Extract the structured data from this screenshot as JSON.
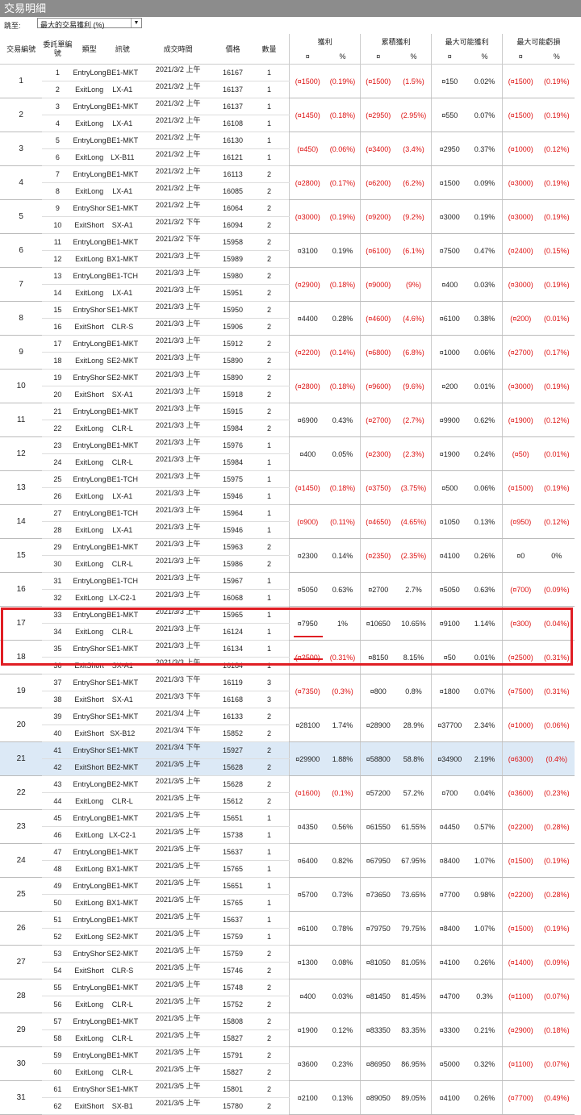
{
  "window_title": "交易明細",
  "toolbar": {
    "jump_label": "跳至:",
    "sort_value": "最大的交易獲利 (%)"
  },
  "headers": {
    "trade_no": "交易編號",
    "order_no": "委託單編號",
    "type": "類型",
    "signal": "訊號",
    "time": "成交時間",
    "price": "價格",
    "qty": "數量",
    "profit": "獲利",
    "cum": "累積獲利",
    "maxp": "最大可能獲利",
    "maxl": "最大可能虧損",
    "cur": "¤",
    "pct": "%"
  },
  "colors": {
    "negative": "#dd1111",
    "highlight_row": "#dce9f6",
    "annotation": "#e01e24"
  },
  "trades": [
    {
      "no": "1",
      "o": [
        [
          "1",
          "EntryLong",
          "BE1-MKT",
          "2021/3/2 上午",
          "16167",
          "1"
        ],
        [
          "2",
          "ExitLong",
          "LX-A1",
          "2021/3/2 上午",
          "16137",
          "1"
        ]
      ],
      "m": [
        "(¤1500)",
        "(0.19%)",
        "(¤1500)",
        "(1.5%)",
        "¤150",
        "0.02%",
        "(¤1500)",
        "(0.19%)"
      ]
    },
    {
      "no": "2",
      "o": [
        [
          "3",
          "EntryLong",
          "BE1-MKT",
          "2021/3/2 上午",
          "16137",
          "1"
        ],
        [
          "4",
          "ExitLong",
          "LX-A1",
          "2021/3/2 上午",
          "16108",
          "1"
        ]
      ],
      "m": [
        "(¤1450)",
        "(0.18%)",
        "(¤2950)",
        "(2.95%)",
        "¤550",
        "0.07%",
        "(¤1500)",
        "(0.19%)"
      ]
    },
    {
      "no": "3",
      "o": [
        [
          "5",
          "EntryLong",
          "BE1-MKT",
          "2021/3/2 上午",
          "16130",
          "1"
        ],
        [
          "6",
          "ExitLong",
          "LX-B11",
          "2021/3/2 上午",
          "16121",
          "1"
        ]
      ],
      "m": [
        "(¤450)",
        "(0.06%)",
        "(¤3400)",
        "(3.4%)",
        "¤2950",
        "0.37%",
        "(¤1000)",
        "(0.12%)"
      ]
    },
    {
      "no": "4",
      "o": [
        [
          "7",
          "EntryLong",
          "BE1-MKT",
          "2021/3/2 上午",
          "16113",
          "2"
        ],
        [
          "8",
          "ExitLong",
          "LX-A1",
          "2021/3/2 上午",
          "16085",
          "2"
        ]
      ],
      "m": [
        "(¤2800)",
        "(0.17%)",
        "(¤6200)",
        "(6.2%)",
        "¤1500",
        "0.09%",
        "(¤3000)",
        "(0.19%)"
      ]
    },
    {
      "no": "5",
      "o": [
        [
          "9",
          "EntryShort",
          "SE1-MKT",
          "2021/3/2 上午",
          "16064",
          "2"
        ],
        [
          "10",
          "ExitShort",
          "SX-A1",
          "2021/3/2 下午",
          "16094",
          "2"
        ]
      ],
      "m": [
        "(¤3000)",
        "(0.19%)",
        "(¤9200)",
        "(9.2%)",
        "¤3000",
        "0.19%",
        "(¤3000)",
        "(0.19%)"
      ]
    },
    {
      "no": "6",
      "o": [
        [
          "11",
          "EntryLong",
          "BE1-MKT",
          "2021/3/2 下午",
          "15958",
          "2"
        ],
        [
          "12",
          "ExitLong",
          "BX1-MKT",
          "2021/3/3 上午",
          "15989",
          "2"
        ]
      ],
      "m": [
        "¤3100",
        "0.19%",
        "(¤6100)",
        "(6.1%)",
        "¤7500",
        "0.47%",
        "(¤2400)",
        "(0.15%)"
      ]
    },
    {
      "no": "7",
      "o": [
        [
          "13",
          "EntryLong",
          "BE1-TCH",
          "2021/3/3 上午",
          "15980",
          "2"
        ],
        [
          "14",
          "ExitLong",
          "LX-A1",
          "2021/3/3 上午",
          "15951",
          "2"
        ]
      ],
      "m": [
        "(¤2900)",
        "(0.18%)",
        "(¤9000)",
        "(9%)",
        "¤400",
        "0.03%",
        "(¤3000)",
        "(0.19%)"
      ]
    },
    {
      "no": "8",
      "o": [
        [
          "15",
          "EntryShort",
          "SE1-MKT",
          "2021/3/3 上午",
          "15950",
          "2"
        ],
        [
          "16",
          "ExitShort",
          "CLR-S",
          "2021/3/3 上午",
          "15906",
          "2"
        ]
      ],
      "m": [
        "¤4400",
        "0.28%",
        "(¤4600)",
        "(4.6%)",
        "¤6100",
        "0.38%",
        "(¤200)",
        "(0.01%)"
      ]
    },
    {
      "no": "9",
      "o": [
        [
          "17",
          "EntryLong",
          "BE1-MKT",
          "2021/3/3 上午",
          "15912",
          "2"
        ],
        [
          "18",
          "ExitLong",
          "SE2-MKT",
          "2021/3/3 上午",
          "15890",
          "2"
        ]
      ],
      "m": [
        "(¤2200)",
        "(0.14%)",
        "(¤6800)",
        "(6.8%)",
        "¤1000",
        "0.06%",
        "(¤2700)",
        "(0.17%)"
      ]
    },
    {
      "no": "10",
      "o": [
        [
          "19",
          "EntryShort",
          "SE2-MKT",
          "2021/3/3 上午",
          "15890",
          "2"
        ],
        [
          "20",
          "ExitShort",
          "SX-A1",
          "2021/3/3 上午",
          "15918",
          "2"
        ]
      ],
      "m": [
        "(¤2800)",
        "(0.18%)",
        "(¤9600)",
        "(9.6%)",
        "¤200",
        "0.01%",
        "(¤3000)",
        "(0.19%)"
      ]
    },
    {
      "no": "11",
      "o": [
        [
          "21",
          "EntryLong",
          "BE1-MKT",
          "2021/3/3 上午",
          "15915",
          "2"
        ],
        [
          "22",
          "ExitLong",
          "CLR-L",
          "2021/3/3 上午",
          "15984",
          "2"
        ]
      ],
      "m": [
        "¤6900",
        "0.43%",
        "(¤2700)",
        "(2.7%)",
        "¤9900",
        "0.62%",
        "(¤1900)",
        "(0.12%)"
      ]
    },
    {
      "no": "12",
      "o": [
        [
          "23",
          "EntryLong",
          "BE1-MKT",
          "2021/3/3 上午",
          "15976",
          "1"
        ],
        [
          "24",
          "ExitLong",
          "CLR-L",
          "2021/3/3 上午",
          "15984",
          "1"
        ]
      ],
      "m": [
        "¤400",
        "0.05%",
        "(¤2300)",
        "(2.3%)",
        "¤1900",
        "0.24%",
        "(¤50)",
        "(0.01%)"
      ]
    },
    {
      "no": "13",
      "o": [
        [
          "25",
          "EntryLong",
          "BE1-TCH",
          "2021/3/3 上午",
          "15975",
          "1"
        ],
        [
          "26",
          "ExitLong",
          "LX-A1",
          "2021/3/3 上午",
          "15946",
          "1"
        ]
      ],
      "m": [
        "(¤1450)",
        "(0.18%)",
        "(¤3750)",
        "(3.75%)",
        "¤500",
        "0.06%",
        "(¤1500)",
        "(0.19%)"
      ]
    },
    {
      "no": "14",
      "o": [
        [
          "27",
          "EntryLong",
          "BE1-TCH",
          "2021/3/3 上午",
          "15964",
          "1"
        ],
        [
          "28",
          "ExitLong",
          "LX-A1",
          "2021/3/3 上午",
          "15946",
          "1"
        ]
      ],
      "m": [
        "(¤900)",
        "(0.11%)",
        "(¤4650)",
        "(4.65%)",
        "¤1050",
        "0.13%",
        "(¤950)",
        "(0.12%)"
      ]
    },
    {
      "no": "15",
      "o": [
        [
          "29",
          "EntryLong",
          "BE1-MKT",
          "2021/3/3 上午",
          "15963",
          "2"
        ],
        [
          "30",
          "ExitLong",
          "CLR-L",
          "2021/3/3 上午",
          "15986",
          "2"
        ]
      ],
      "m": [
        "¤2300",
        "0.14%",
        "(¤2350)",
        "(2.35%)",
        "¤4100",
        "0.26%",
        "¤0",
        "0%"
      ]
    },
    {
      "no": "16",
      "o": [
        [
          "31",
          "EntryLong",
          "BE1-TCH",
          "2021/3/3 上午",
          "15967",
          "1"
        ],
        [
          "32",
          "ExitLong",
          "LX-C2-1",
          "2021/3/3 上午",
          "16068",
          "1"
        ]
      ],
      "m": [
        "¤5050",
        "0.63%",
        "¤2700",
        "2.7%",
        "¤5050",
        "0.63%",
        "(¤700)",
        "(0.09%)"
      ]
    },
    {
      "no": "17",
      "o": [
        [
          "33",
          "EntryLong",
          "BE1-MKT",
          "2021/3/3 上午",
          "15965",
          "1"
        ],
        [
          "34",
          "ExitLong",
          "CLR-L",
          "2021/3/3 上午",
          "16124",
          "1"
        ]
      ],
      "m": [
        "¤7950",
        "1%",
        "¤10650",
        "10.65%",
        "¤9100",
        "1.14%",
        "(¤300)",
        "(0.04%)"
      ]
    },
    {
      "no": "18",
      "o": [
        [
          "35",
          "EntryShort",
          "SE1-MKT",
          "2021/3/3 上午",
          "16134",
          "1"
        ],
        [
          "36",
          "ExitShort",
          "SX-A1",
          "2021/3/3 上午",
          "16184",
          "1"
        ]
      ],
      "m": [
        "(¤2500)",
        "(0.31%)",
        "¤8150",
        "8.15%",
        "¤50",
        "0.01%",
        "(¤2500)",
        "(0.31%)"
      ]
    },
    {
      "no": "19",
      "o": [
        [
          "37",
          "EntryShort",
          "SE1-MKT",
          "2021/3/3 下午",
          "16119",
          "3"
        ],
        [
          "38",
          "ExitShort",
          "SX-A1",
          "2021/3/3 下午",
          "16168",
          "3"
        ]
      ],
      "m": [
        "(¤7350)",
        "(0.3%)",
        "¤800",
        "0.8%",
        "¤1800",
        "0.07%",
        "(¤7500)",
        "(0.31%)"
      ]
    },
    {
      "no": "20",
      "o": [
        [
          "39",
          "EntryShort",
          "SE1-MKT",
          "2021/3/4 上午",
          "16133",
          "2"
        ],
        [
          "40",
          "ExitShort",
          "SX-B12",
          "2021/3/4 下午",
          "15852",
          "2"
        ]
      ],
      "m": [
        "¤28100",
        "1.74%",
        "¤28900",
        "28.9%",
        "¤37700",
        "2.34%",
        "(¤1000)",
        "(0.06%)"
      ]
    },
    {
      "no": "21",
      "o": [
        [
          "41",
          "EntryShort",
          "SE1-MKT",
          "2021/3/4 下午",
          "15927",
          "2"
        ],
        [
          "42",
          "ExitShort",
          "BE2-MKT",
          "2021/3/5 上午",
          "15628",
          "2"
        ]
      ],
      "m": [
        "¤29900",
        "1.88%",
        "¤58800",
        "58.8%",
        "¤34900",
        "2.19%",
        "(¤6300)",
        "(0.4%)"
      ]
    },
    {
      "no": "22",
      "o": [
        [
          "43",
          "EntryLong",
          "BE2-MKT",
          "2021/3/5 上午",
          "15628",
          "2"
        ],
        [
          "44",
          "ExitLong",
          "CLR-L",
          "2021/3/5 上午",
          "15612",
          "2"
        ]
      ],
      "m": [
        "(¤1600)",
        "(0.1%)",
        "¤57200",
        "57.2%",
        "¤700",
        "0.04%",
        "(¤3600)",
        "(0.23%)"
      ]
    },
    {
      "no": "23",
      "o": [
        [
          "45",
          "EntryLong",
          "BE1-MKT",
          "2021/3/5 上午",
          "15651",
          "1"
        ],
        [
          "46",
          "ExitLong",
          "LX-C2-1",
          "2021/3/5 上午",
          "15738",
          "1"
        ]
      ],
      "m": [
        "¤4350",
        "0.56%",
        "¤61550",
        "61.55%",
        "¤4450",
        "0.57%",
        "(¤2200)",
        "(0.28%)"
      ]
    },
    {
      "no": "24",
      "o": [
        [
          "47",
          "EntryLong",
          "BE1-MKT",
          "2021/3/5 上午",
          "15637",
          "1"
        ],
        [
          "48",
          "ExitLong",
          "BX1-MKT",
          "2021/3/5 上午",
          "15765",
          "1"
        ]
      ],
      "m": [
        "¤6400",
        "0.82%",
        "¤67950",
        "67.95%",
        "¤8400",
        "1.07%",
        "(¤1500)",
        "(0.19%)"
      ]
    },
    {
      "no": "25",
      "o": [
        [
          "49",
          "EntryLong",
          "BE1-MKT",
          "2021/3/5 上午",
          "15651",
          "1"
        ],
        [
          "50",
          "ExitLong",
          "BX1-MKT",
          "2021/3/5 上午",
          "15765",
          "1"
        ]
      ],
      "m": [
        "¤5700",
        "0.73%",
        "¤73650",
        "73.65%",
        "¤7700",
        "0.98%",
        "(¤2200)",
        "(0.28%)"
      ]
    },
    {
      "no": "26",
      "o": [
        [
          "51",
          "EntryLong",
          "BE1-MKT",
          "2021/3/5 上午",
          "15637",
          "1"
        ],
        [
          "52",
          "ExitLong",
          "SE2-MKT",
          "2021/3/5 上午",
          "15759",
          "1"
        ]
      ],
      "m": [
        "¤6100",
        "0.78%",
        "¤79750",
        "79.75%",
        "¤8400",
        "1.07%",
        "(¤1500)",
        "(0.19%)"
      ]
    },
    {
      "no": "27",
      "o": [
        [
          "53",
          "EntryShort",
          "SE2-MKT",
          "2021/3/5 上午",
          "15759",
          "2"
        ],
        [
          "54",
          "ExitShort",
          "CLR-S",
          "2021/3/5 上午",
          "15746",
          "2"
        ]
      ],
      "m": [
        "¤1300",
        "0.08%",
        "¤81050",
        "81.05%",
        "¤4100",
        "0.26%",
        "(¤1400)",
        "(0.09%)"
      ]
    },
    {
      "no": "28",
      "o": [
        [
          "55",
          "EntryLong",
          "BE1-MKT",
          "2021/3/5 上午",
          "15748",
          "2"
        ],
        [
          "56",
          "ExitLong",
          "CLR-L",
          "2021/3/5 上午",
          "15752",
          "2"
        ]
      ],
      "m": [
        "¤400",
        "0.03%",
        "¤81450",
        "81.45%",
        "¤4700",
        "0.3%",
        "(¤1100)",
        "(0.07%)"
      ]
    },
    {
      "no": "29",
      "o": [
        [
          "57",
          "EntryLong",
          "BE1-MKT",
          "2021/3/5 上午",
          "15808",
          "2"
        ],
        [
          "58",
          "ExitLong",
          "CLR-L",
          "2021/3/5 上午",
          "15827",
          "2"
        ]
      ],
      "m": [
        "¤1900",
        "0.12%",
        "¤83350",
        "83.35%",
        "¤3300",
        "0.21%",
        "(¤2900)",
        "(0.18%)"
      ]
    },
    {
      "no": "30",
      "o": [
        [
          "59",
          "EntryLong",
          "BE1-MKT",
          "2021/3/5 上午",
          "15791",
          "2"
        ],
        [
          "60",
          "ExitLong",
          "CLR-L",
          "2021/3/5 上午",
          "15827",
          "2"
        ]
      ],
      "m": [
        "¤3600",
        "0.23%",
        "¤86950",
        "86.95%",
        "¤5000",
        "0.32%",
        "(¤1100)",
        "(0.07%)"
      ]
    },
    {
      "no": "31",
      "o": [
        [
          "61",
          "EntryShort",
          "SE1-MKT",
          "2021/3/5 上午",
          "15801",
          "2"
        ],
        [
          "62",
          "ExitShort",
          "SX-B1",
          "2021/3/5 上午",
          "15780",
          "2"
        ]
      ],
      "m": [
        "¤2100",
        "0.13%",
        "¤89050",
        "89.05%",
        "¤4100",
        "0.26%",
        "(¤7700)",
        "(0.49%)"
      ]
    }
  ]
}
